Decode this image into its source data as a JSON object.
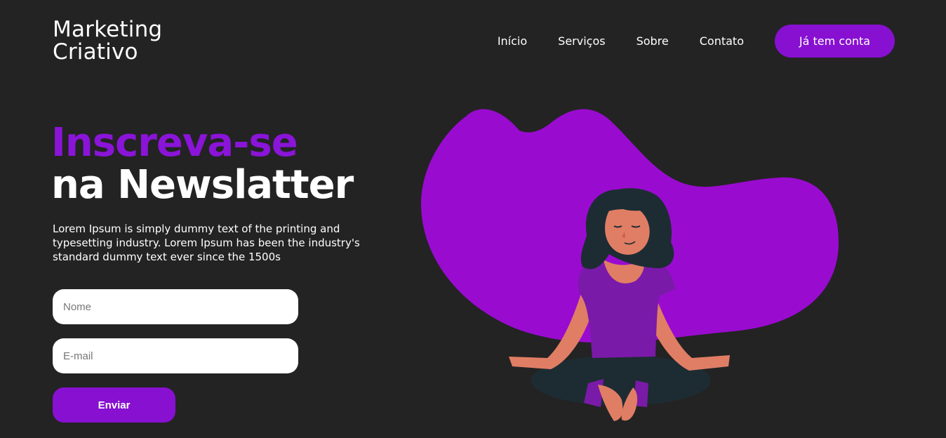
{
  "brand": {
    "line1": "Marketing",
    "line2": "Criativo"
  },
  "nav": {
    "items": [
      {
        "label": "Início",
        "id": "inicio"
      },
      {
        "label": "Serviços",
        "id": "servicos"
      },
      {
        "label": "Sobre",
        "id": "sobre"
      },
      {
        "label": "Contato",
        "id": "contato"
      }
    ],
    "cta_label": "Já tem conta"
  },
  "hero": {
    "title_accent": "Inscreva-se",
    "title_rest": "na Newslatter",
    "description": "Lorem Ipsum is simply dummy text of the printing and typesetting industry. Lorem Ipsum has been the industry's standard dummy text ever since the 1500s"
  },
  "form": {
    "name_placeholder": "Nome",
    "email_placeholder": "E-mail",
    "submit_label": "Enviar"
  },
  "colors": {
    "background": "#232323",
    "accent": "#8710d1",
    "blob": "#9a0bd0",
    "text": "#ffffff"
  },
  "illustration": {
    "name": "meditating-woman-illustration"
  }
}
